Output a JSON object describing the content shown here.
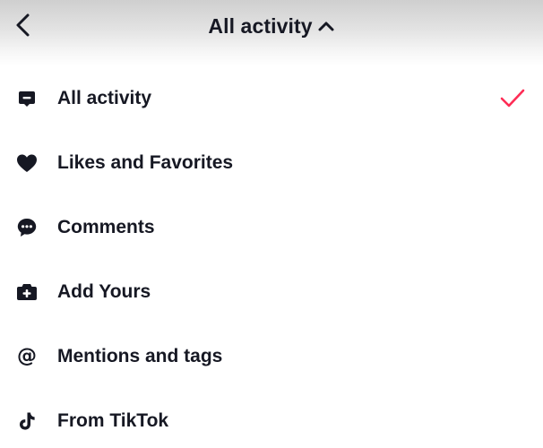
{
  "header": {
    "title": "All activity"
  },
  "menu": {
    "items": [
      {
        "label": "All activity",
        "icon": "inbox-message-icon",
        "selected": true
      },
      {
        "label": "Likes and Favorites",
        "icon": "heart-icon",
        "selected": false
      },
      {
        "label": "Comments",
        "icon": "comment-bubble-icon",
        "selected": false
      },
      {
        "label": "Add Yours",
        "icon": "add-yours-icon",
        "selected": false
      },
      {
        "label": "Mentions and tags",
        "icon": "at-sign-icon",
        "selected": false
      },
      {
        "label": "From TikTok",
        "icon": "tiktok-logo-icon",
        "selected": false
      }
    ]
  },
  "colors": {
    "accent": "#fe2c55",
    "text": "#161823"
  }
}
